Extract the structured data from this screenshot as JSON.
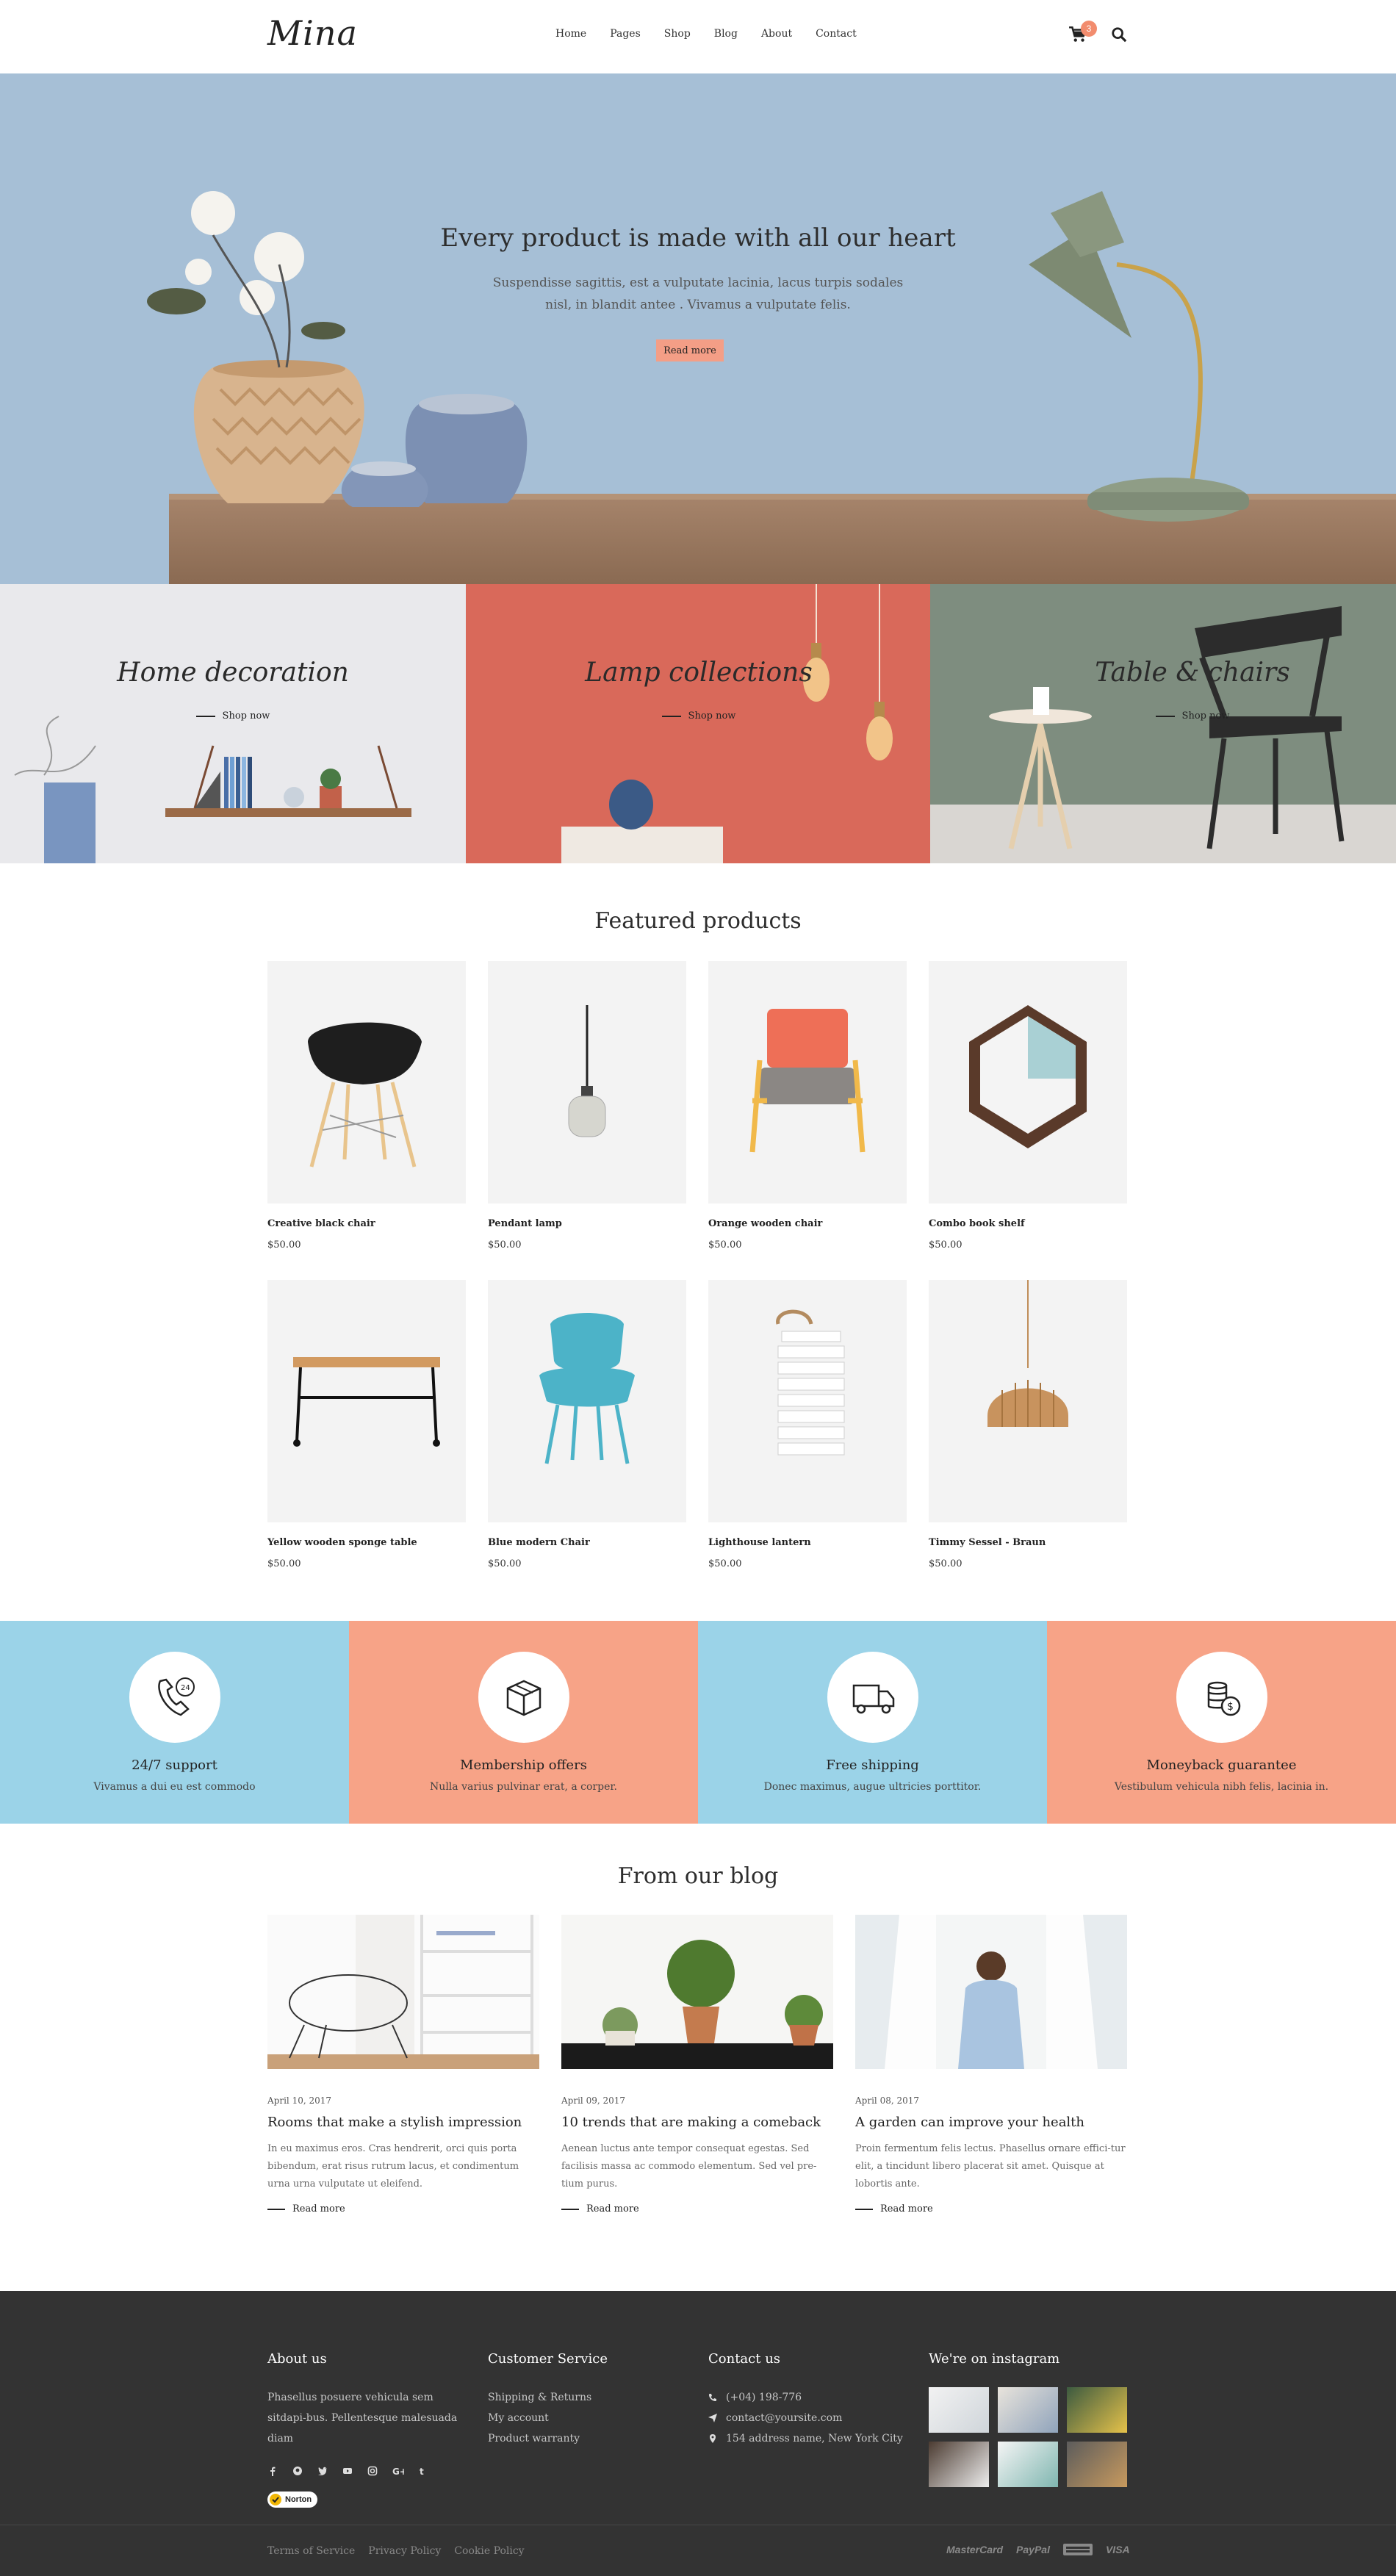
{
  "header": {
    "logo": "Mina",
    "nav": [
      "Home",
      "Pages",
      "Shop",
      "Blog",
      "About",
      "Contact"
    ],
    "cart_count": "3"
  },
  "hero": {
    "title": "Every product is made with all our heart",
    "subtitle": "Suspendisse sagittis, est a vulputate lacinia, lacus turpis sodales nisl, in blandit antee . Vivamus a vulputate felis.",
    "button": "Read more"
  },
  "categories": [
    {
      "title": "Home decoration",
      "link": "Shop now"
    },
    {
      "title": "Lamp collections",
      "link": "Shop now"
    },
    {
      "title": "Table & chairs",
      "link": "Shop now"
    }
  ],
  "featured": {
    "title": "Featured products",
    "products": [
      {
        "name": "Creative black chair",
        "price": "$50.00"
      },
      {
        "name": "Pendant lamp",
        "price": "$50.00"
      },
      {
        "name": "Orange wooden chair",
        "price": "$50.00"
      },
      {
        "name": "Combo book shelf",
        "price": "$50.00"
      },
      {
        "name": "Yellow wooden sponge table",
        "price": "$50.00"
      },
      {
        "name": "Blue modern Chair",
        "price": "$50.00"
      },
      {
        "name": "Lighthouse lantern",
        "price": "$50.00"
      },
      {
        "name": "Timmy Sessel - Braun",
        "price": "$50.00"
      }
    ]
  },
  "features": [
    {
      "title": "24/7 support",
      "desc": "Vivamus a dui eu est commodo",
      "icon": "support-phone-icon",
      "color": "#9bd3e8"
    },
    {
      "title": "Membership offers",
      "desc": "Nulla varius pulvinar erat, a corper.",
      "icon": "gift-box-icon",
      "color": "#f7a387"
    },
    {
      "title": "Free shipping",
      "desc": "Donec maximus, augue ultricies porttitor.",
      "icon": "delivery-truck-icon",
      "color": "#9bd3e8"
    },
    {
      "title": "Moneyback guarantee",
      "desc": "Vestibulum vehicula nibh felis, lacinia in.",
      "icon": "coins-dollar-icon",
      "color": "#f7a387"
    }
  ],
  "blog": {
    "title": "From our blog",
    "posts": [
      {
        "date": "April 10, 2017",
        "title": "Rooms that make a stylish impression",
        "excerpt": "In eu maximus eros. Cras hendrerit, orci quis porta bibendum, erat risus rutrum lacus, et condimentum urna urna vulputate ut eleifend.",
        "more": "Read more"
      },
      {
        "date": "April 09, 2017",
        "title": "10 trends that are making a comeback",
        "excerpt": "Aenean luctus ante tempor consequat egestas. Sed facilisis massa ac commodo elementum. Sed vel pre-tium purus.",
        "more": "Read more"
      },
      {
        "date": "April 08, 2017",
        "title": "A garden can improve your health",
        "excerpt": "Proin fermentum felis lectus. Phasellus ornare effici-tur elit, a tincidunt libero placerat sit amet. Quisque at lobortis ante.",
        "more": "Read more"
      }
    ]
  },
  "footer": {
    "about_title": "About us",
    "about_text": "Phasellus posuere vehicula sem sitdapi-bus. Pellentesque malesuada diam",
    "badge": "Norton",
    "service_title": "Customer Service",
    "service_links": [
      "Shipping & Returns",
      "My account",
      "Product warranty"
    ],
    "contact_title": "Contact us",
    "phone": "(+04) 198-776",
    "email": "contact@yoursite.com",
    "address": "154 address name, New York City",
    "instagram_title": "We're on instagram",
    "legal": [
      "Terms of Service",
      "Privacy Policy",
      "Cookie Policy"
    ],
    "payments": [
      "MasterCard",
      "PayPal",
      "VISA"
    ]
  }
}
